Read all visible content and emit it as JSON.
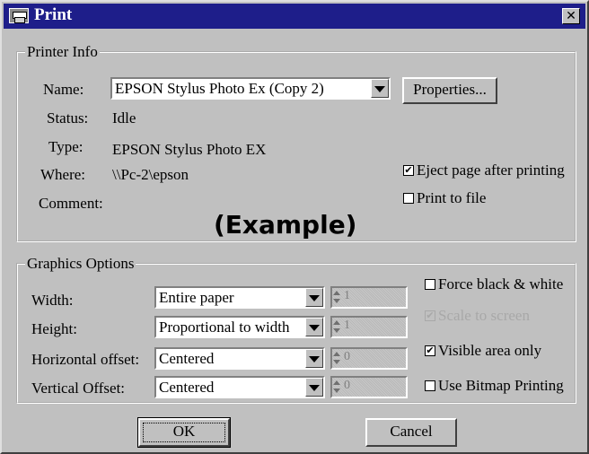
{
  "window": {
    "title": "Print"
  },
  "printer_info": {
    "legend": "Printer Info",
    "name_label": "Name:",
    "name_value": "EPSON Stylus Photo Ex (Copy 2)",
    "properties_label": "Properties...",
    "status_label": "Status:",
    "status_value": "Idle",
    "type_label": "Type:",
    "type_value": "EPSON Stylus Photo EX",
    "where_label": "Where:",
    "where_value": "\\\\Pc-2\\epson",
    "comment_label": "Comment:",
    "eject_label": "Eject page after printing",
    "eject_checked": true,
    "print_to_file_label": "Print to file",
    "print_to_file_checked": false
  },
  "overlay_text": "(Example)",
  "graphics_options": {
    "legend": "Graphics Options",
    "width_label": "Width:",
    "width_value": "Entire paper",
    "height_label": "Height:",
    "height_value": "Proportional to width",
    "hoffset_label": "Horizontal offset:",
    "hoffset_value": "Centered",
    "voffset_label": "Vertical Offset:",
    "voffset_value": "Centered",
    "spin_values": [
      "1",
      "1",
      "0",
      "0"
    ],
    "force_bw_label": "Force black & white",
    "force_bw_checked": false,
    "scale_to_screen_label": "Scale to screen",
    "scale_to_screen_checked": true,
    "visible_area_label": "Visible area only",
    "visible_area_checked": true,
    "bitmap_label": "Use Bitmap Printing",
    "bitmap_checked": false
  },
  "buttons": {
    "ok": "OK",
    "cancel": "Cancel"
  },
  "icons": {
    "check_mark": "✔",
    "close": "✕"
  }
}
